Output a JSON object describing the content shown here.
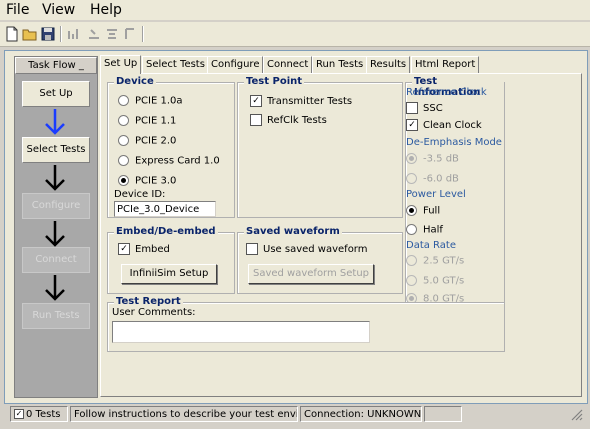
{
  "menu": {
    "file": "File",
    "view": "View",
    "help": "Help"
  },
  "taskflow": {
    "header": "Task Flow",
    "steps": [
      {
        "label": "Set Up",
        "enabled": true
      },
      {
        "label": "Select Tests",
        "enabled": true
      },
      {
        "label": "Configure",
        "enabled": false
      },
      {
        "label": "Connect",
        "enabled": false
      },
      {
        "label": "Run Tests",
        "enabled": false
      }
    ]
  },
  "tabs": [
    "Set Up",
    "Select Tests",
    "Configure",
    "Connect",
    "Run Tests",
    "Results",
    "Html Report"
  ],
  "device": {
    "title": "Device",
    "options": [
      "PCIE 1.0a",
      "PCIE 1.1",
      "PCIE 2.0",
      "Express Card 1.0",
      "PCIE 3.0"
    ],
    "selected": "PCIE 3.0",
    "id_label": "Device ID:",
    "id_value": "PCIe_3.0_Device"
  },
  "test_point": {
    "title": "Test Point",
    "items": [
      {
        "label": "Transmitter Tests",
        "checked": true
      },
      {
        "label": "RefClk Tests",
        "checked": false
      }
    ]
  },
  "test_info": {
    "title": "Test Information",
    "ref_clock_label": "Reference Clock",
    "ref_clock": [
      {
        "label": "SSC",
        "checked": false
      },
      {
        "label": "Clean Clock",
        "checked": true
      }
    ],
    "deemph_label": "De-Emphasis Mode",
    "deemph": [
      {
        "label": "-3.5 dB",
        "on": true
      },
      {
        "label": "-6.0 dB",
        "on": false
      }
    ],
    "power_label": "Power Level",
    "power": [
      {
        "label": "Full",
        "on": true
      },
      {
        "label": "Half",
        "on": false
      }
    ],
    "rate_label": "Data Rate",
    "rates": [
      {
        "label": "2.5 GT/s",
        "on": false
      },
      {
        "label": "5.0 GT/s",
        "on": false
      },
      {
        "label": "8.0 GT/s",
        "on": true
      }
    ]
  },
  "embed": {
    "title": "Embed/De-embed",
    "checkbox_label": "Embed",
    "checked": true,
    "button": "InfiniiSim Setup"
  },
  "saved": {
    "title": "Saved waveform",
    "checkbox_label": "Use saved waveform",
    "checked": false,
    "button": "Saved waveform Setup"
  },
  "report": {
    "title": "Test Report",
    "comments_label": "User Comments:",
    "comments_value": ""
  },
  "status": {
    "tests": "0 Tests",
    "message": "Follow instructions to describe your test environment",
    "connection": "Connection: UNKNOWN"
  },
  "colors": {
    "group_title": "#0a246a",
    "subsection_label": "#2c5aa0",
    "flow_arrow_active": "#1a3cff"
  }
}
